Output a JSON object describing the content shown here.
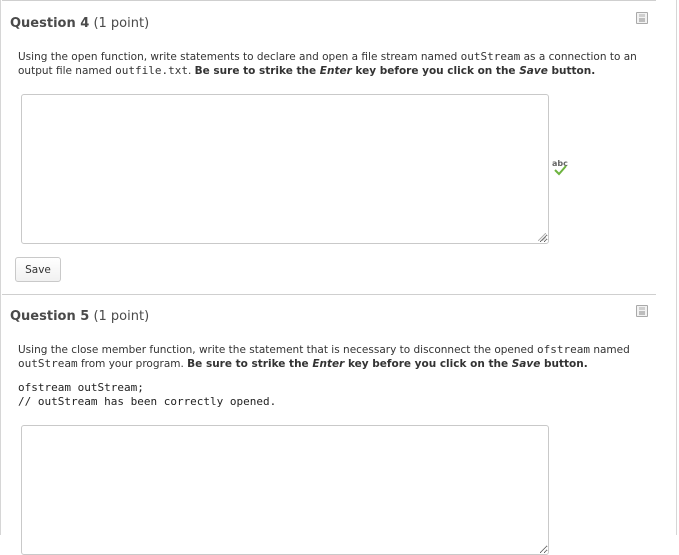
{
  "questions": [
    {
      "label": "Question 4",
      "points": "(1 point)",
      "prompt": {
        "p1": "Using the open function, write statements to declare and open a file stream named ",
        "c1": "outStream",
        "p2": " as a connection to an output file named ",
        "c2": "outfile.txt",
        "p3": ". ",
        "b1": "Be sure to strike the ",
        "b2": "Enter",
        "b3": " key before you click on the ",
        "b4": "Save",
        "b5": " button."
      },
      "answer": "",
      "save_label": "Save"
    },
    {
      "label": "Question 5",
      "points": "(1 point)",
      "prompt": {
        "p1": "Using the close member function, write the statement that is necessary to disconnect the opened ",
        "c1": "ofstream",
        "p2": " named ",
        "c2": "outStream",
        "p3": " from your program. ",
        "b1": "Be sure to strike the ",
        "b2": "Enter",
        "b3": " key before you click on the ",
        "b4": "Save",
        "b5": " button."
      },
      "code": "ofstream outStream;\n// outStream has been correctly opened.",
      "answer": ""
    }
  ],
  "icons": {
    "save_page": "floppy-disk-icon",
    "spellcheck": "spellcheck-icon",
    "spellcheck_text": "abc",
    "spellcheck_color": "#6db33f"
  }
}
